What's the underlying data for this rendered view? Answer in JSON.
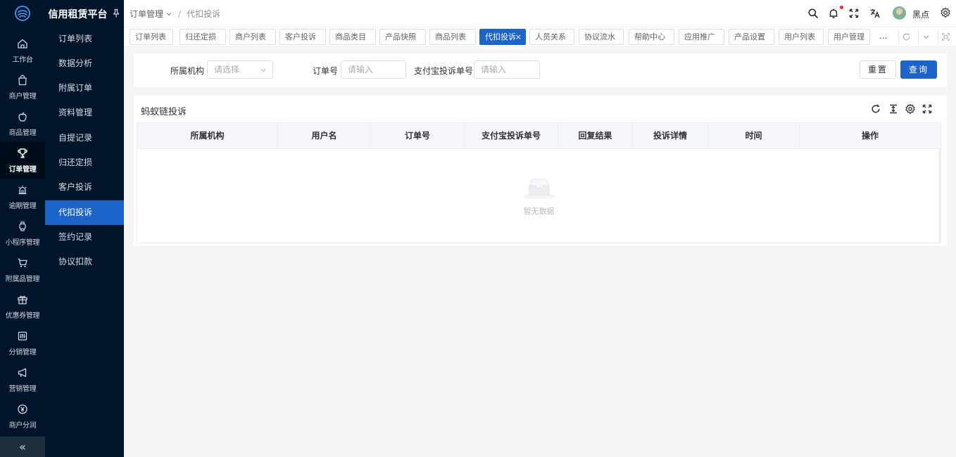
{
  "app": {
    "title": "信用租赁平台"
  },
  "rail": {
    "items": [
      {
        "label": "工作台",
        "icon": "home-icon"
      },
      {
        "label": "商户管理",
        "icon": "shopping-bag-icon"
      },
      {
        "label": "商品管理",
        "icon": "apple-icon"
      },
      {
        "label": "订单管理",
        "icon": "trophy-icon"
      },
      {
        "label": "逾期管理",
        "icon": "alarm-icon"
      },
      {
        "label": "小程序管理",
        "icon": "watch-icon"
      },
      {
        "label": "附属品管理",
        "icon": "cart-icon"
      },
      {
        "label": "优惠券管理",
        "icon": "gift-icon"
      },
      {
        "label": "分销管理",
        "icon": "sliders-icon"
      },
      {
        "label": "营销管理",
        "icon": "megaphone-icon"
      },
      {
        "label": "商户分润",
        "icon": "yen-icon"
      }
    ],
    "active_index": 3,
    "collapse_glyph": "«"
  },
  "submenu": {
    "items": [
      "订单列表",
      "数据分析",
      "附属订单",
      "资料管理",
      "自提记录",
      "归还定损",
      "客户投诉",
      "代扣投诉",
      "签约记录",
      "协议扣款"
    ],
    "active_index": 7
  },
  "header": {
    "breadcrumb": {
      "parent": "订单管理",
      "separator": "/",
      "current": "代扣投诉"
    },
    "username": "黑点",
    "has_notification": true
  },
  "tabs": {
    "items": [
      "订单列表",
      "归还定损",
      "商户列表",
      "客户投诉",
      "商品类目",
      "产品快照",
      "商品列表",
      "代扣投诉",
      "人员关系",
      "协议流水",
      "帮助中心",
      "应用推广",
      "产品设置",
      "用户列表",
      "用户管理"
    ],
    "active_index": 7,
    "close_glyph": "×",
    "more_glyph": "..."
  },
  "search": {
    "org_label": "所属机构",
    "org_placeholder": "请选择",
    "order_label": "订单号",
    "order_placeholder": "请输入",
    "alipay_label": "支付宝投诉单号",
    "alipay_placeholder": "请输入",
    "reset_label": "重置",
    "query_label": "查询"
  },
  "table": {
    "title": "蚂蚁链投诉",
    "columns": [
      "所属机构",
      "用户名",
      "订单号",
      "支付宝投诉单号",
      "回复结果",
      "投诉详情",
      "时间",
      "操作"
    ],
    "rows": [],
    "empty_text": "暂无数据"
  },
  "colors": {
    "sidebar_bg": "#001529",
    "accent": "#1c64c9",
    "page_bg": "#f5f5f5",
    "notification_dot": "#f5222d"
  }
}
